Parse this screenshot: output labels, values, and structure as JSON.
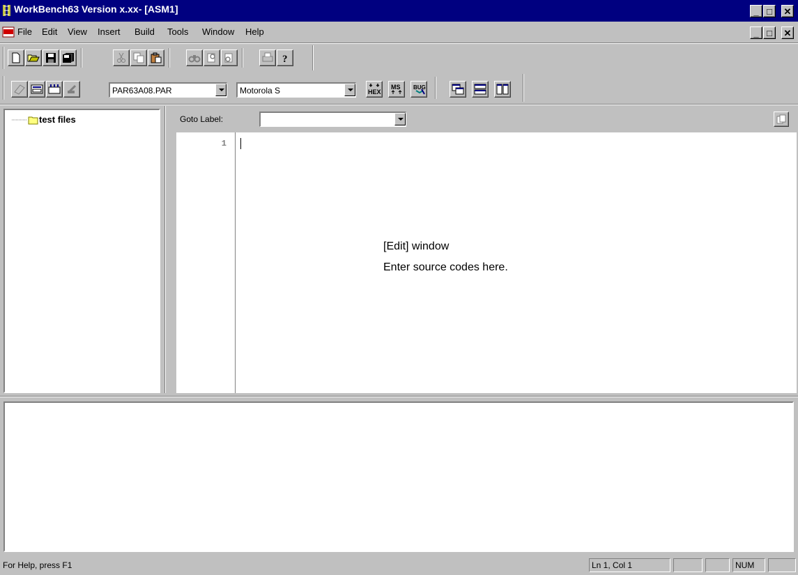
{
  "window": {
    "title": "WorkBench63  Version x.xx- [ASM1]"
  },
  "menu": {
    "items": [
      "File",
      "Edit",
      "View",
      "Insert",
      "Build",
      "Tools",
      "Window",
      "Help"
    ]
  },
  "toolbar2": {
    "par_file": "PAR63A08.PAR",
    "format": "Motorola S",
    "hex_label": "HEX",
    "ms_label": "MS",
    "bug_label": "BUG"
  },
  "project_tree": {
    "root_label": "test files"
  },
  "editor": {
    "goto_label": "Goto Label:",
    "goto_value": "",
    "line_numbers": [
      "1"
    ],
    "annotation_line1": "[Edit] window",
    "annotation_line2": "Enter source codes here."
  },
  "status": {
    "help_text": "For Help, press F1",
    "position": "Ln 1, Col 1",
    "num": "NUM"
  },
  "colors": {
    "titlebar": "#000080",
    "face": "#c0c0c0"
  }
}
